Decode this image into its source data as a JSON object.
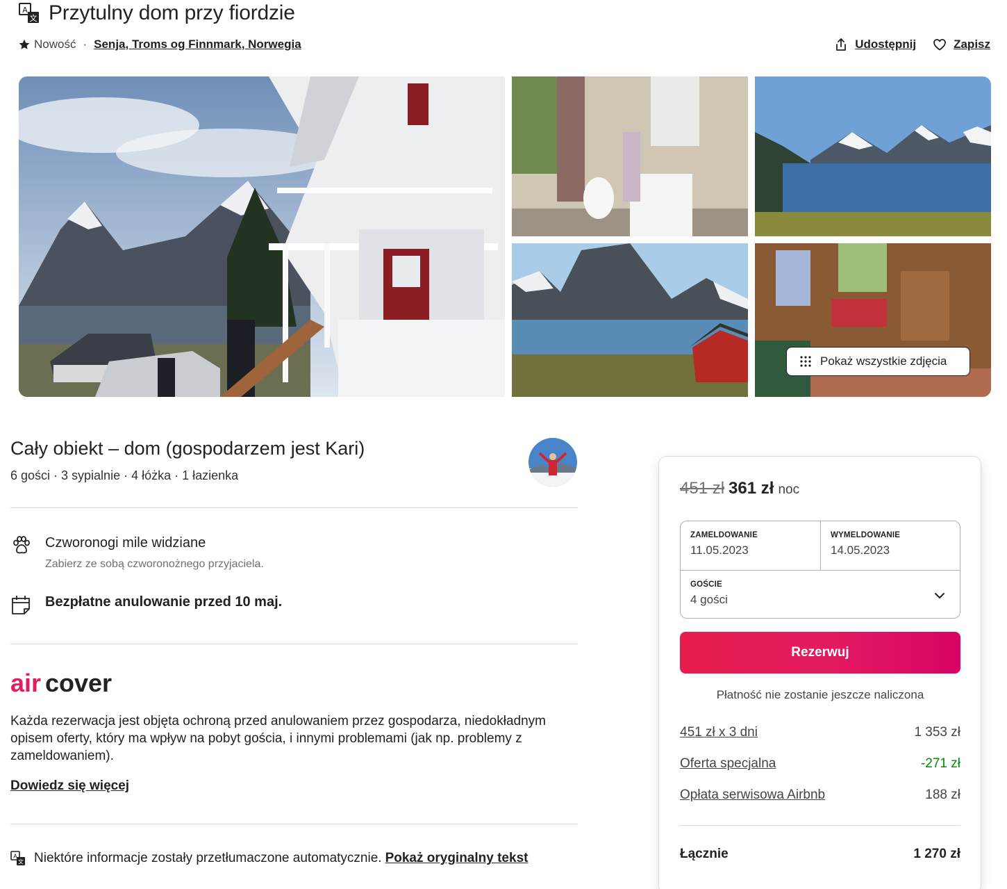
{
  "header": {
    "title": "Przytulny dom przy fiordzie",
    "badge": "Nowość",
    "separator": "·",
    "location": "Senja, Troms og Finnmark, Norwegia",
    "share_label": "Udostępnij",
    "save_label": "Zapisz"
  },
  "gallery": {
    "show_all_label": "Pokaż wszystkie zdjęcia"
  },
  "listing": {
    "title": "Cały obiekt – dom (gospodarzem jest Kari)",
    "meta": "6 gości · 3 sypialnie · 4 łóżka · 1 łazienka",
    "features": [
      {
        "title": "Czworonogi mile widziane",
        "subtitle": "Zabierz ze sobą czworonożnego przyjaciela.",
        "icon": "paw-icon"
      },
      {
        "title": "Bezpłatne anulowanie przed 10 maj.",
        "subtitle": "",
        "icon": "calendar-icon"
      }
    ],
    "aircover": {
      "description": "Każda rezerwacja jest objęta ochroną przed anulowaniem przez gospodarza, niedokładnym opisem oferty, który ma wpływ na pobyt gościa, i innymi problemami (jak np. problemy z zameldowaniem).",
      "learn_more": "Dowiedz się więcej"
    },
    "translation_note": "Niektóre informacje zostały przetłumaczone automatycznie.",
    "show_original": "Pokaż oryginalny tekst"
  },
  "booking": {
    "old_price": "451 zł",
    "new_price": "361 zł",
    "unit": "noc",
    "checkin_label": "ZAMELDOWANIE",
    "checkin_value": "11.05.2023",
    "checkout_label": "WYMELDOWANIE",
    "checkout_value": "14.05.2023",
    "guests_label": "GOŚCIE",
    "guests_value": "4 gości",
    "reserve_label": "Rezerwuj",
    "no_charge": "Płatność nie zostanie jeszcze naliczona",
    "lines": [
      {
        "label": "451 zł x 3 dni",
        "amount": "1 353 zł"
      },
      {
        "label": "Oferta specjalna",
        "amount": "-271 zł"
      },
      {
        "label": "Opłata serwisowa Airbnb",
        "amount": "188 zł"
      }
    ],
    "total_label": "Łącznie",
    "total_value": "1 270 zł"
  },
  "colors": {
    "brand": "#e31c5f",
    "discount": "#008a05",
    "text": "#222222",
    "muted": "#717171"
  }
}
